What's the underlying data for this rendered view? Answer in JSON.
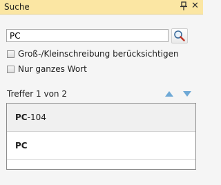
{
  "panel": {
    "title": "Suche"
  },
  "search": {
    "value": "PC"
  },
  "options": [
    {
      "label": "Groß-/Kleinschreibung berücksichtigen",
      "checked": false
    },
    {
      "label": "Nur ganzes Wort",
      "checked": false
    }
  ],
  "results": {
    "summary": "Treffer 1 von 2",
    "items": [
      {
        "match": "PC",
        "rest": "-104"
      },
      {
        "match": "PC",
        "rest": ""
      }
    ]
  },
  "colors": {
    "titlebar": "#fbe6a3",
    "arrow": "#6fa9d6",
    "selected_row": "#f0f0f0"
  }
}
